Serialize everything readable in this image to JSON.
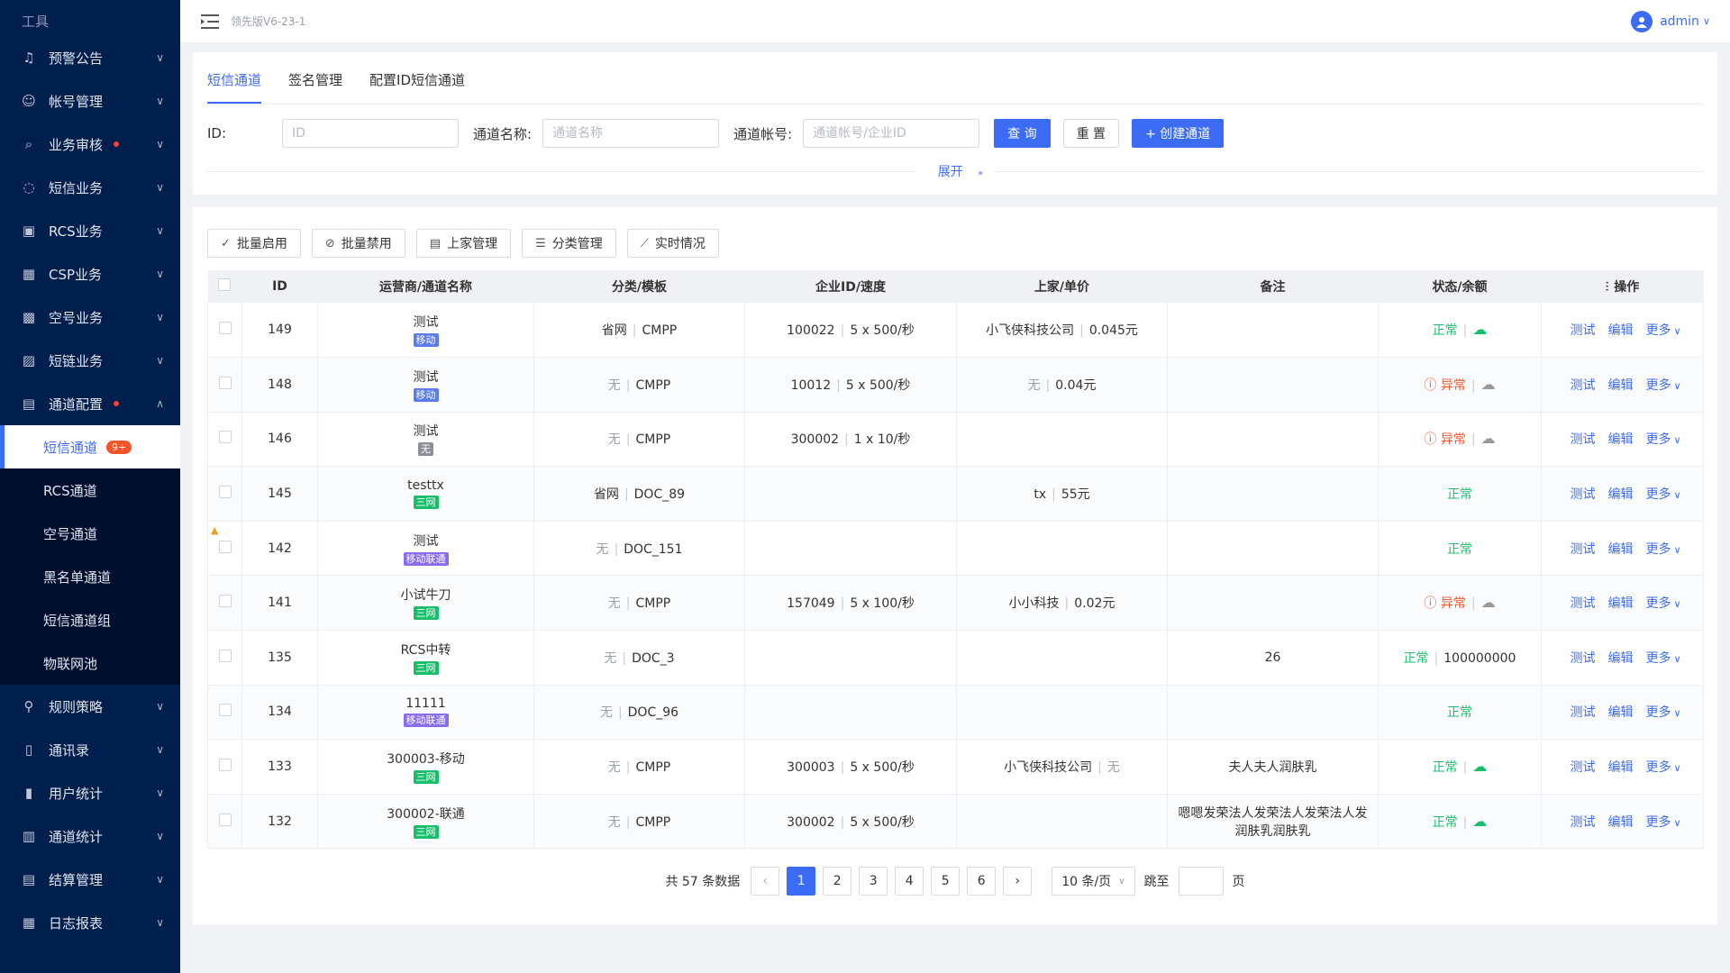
{
  "header": {
    "version": "领先版V6-23-1",
    "user": "admin"
  },
  "sidebar": {
    "top_label": "工具",
    "items": [
      {
        "label": "预警公告",
        "icon": "bell-icon",
        "dot": false
      },
      {
        "label": "帐号管理",
        "icon": "account-icon",
        "dot": false
      },
      {
        "label": "业务审核",
        "icon": "audit-icon",
        "dot": true
      },
      {
        "label": "短信业务",
        "icon": "message-icon",
        "dot": false
      },
      {
        "label": "RCS业务",
        "icon": "rcs-icon",
        "dot": false
      },
      {
        "label": "CSP业务",
        "icon": "csp-icon",
        "dot": false
      },
      {
        "label": "空号业务",
        "icon": "empty-number-icon",
        "dot": false
      },
      {
        "label": "短链业务",
        "icon": "link-icon",
        "dot": false
      },
      {
        "label": "通道配置",
        "icon": "channel-config-icon",
        "dot": true
      }
    ],
    "sub_items": [
      {
        "label": "短信通道",
        "badge": "9+",
        "active": true
      },
      {
        "label": "RCS通道"
      },
      {
        "label": "空号通道"
      },
      {
        "label": "黑名单通道"
      },
      {
        "label": "短信通道组"
      },
      {
        "label": "物联网池"
      }
    ],
    "items_after": [
      {
        "label": "规则策略",
        "icon": "rule-icon"
      },
      {
        "label": "通讯录",
        "icon": "contacts-icon"
      },
      {
        "label": "用户统计",
        "icon": "user-stats-icon"
      },
      {
        "label": "通道统计",
        "icon": "channel-stats-icon"
      },
      {
        "label": "结算管理",
        "icon": "settlement-icon"
      },
      {
        "label": "日志报表",
        "icon": "log-icon"
      }
    ]
  },
  "tabs": [
    "短信通道",
    "签名管理",
    "配置ID短信通道"
  ],
  "filters": {
    "id_label": "ID:",
    "id_placeholder": "ID",
    "name_label": "通道名称:",
    "name_placeholder": "通道名称",
    "account_label": "通道帐号:",
    "account_placeholder": "通道帐号/企业ID",
    "query": "查 询",
    "reset": "重 置",
    "create": "+ 创建通道",
    "expand": "展开"
  },
  "toolbar": [
    "批量启用",
    "批量禁用",
    "上家管理",
    "分类管理",
    "实时情况"
  ],
  "table": {
    "columns": [
      "ID",
      "运营商/通道名称",
      "分类/模板",
      "企业ID/速度",
      "上家/单价",
      "备注",
      "状态/余额",
      "操作"
    ],
    "rows": [
      {
        "id": "149",
        "name": "测试",
        "tag": "移动",
        "tag_color": "#5b7bf2",
        "cat": "省网",
        "tpl": "CMPP",
        "ent": "100022",
        "speed": "5 x 500/秒",
        "up": "小飞侠科技公司",
        "price": "0.045元",
        "note": "",
        "status": "正常",
        "status_type": "ok",
        "cloud": "ok",
        "balance": ""
      },
      {
        "id": "148",
        "name": "测试",
        "tag": "移动",
        "tag_color": "#5b7bf2",
        "cat": "无",
        "tpl": "CMPP",
        "ent": "10012",
        "speed": "5 x 500/秒",
        "up": "无",
        "price": "0.04元",
        "note": "",
        "status": "异常",
        "status_type": "err",
        "cloud": "gray",
        "balance": ""
      },
      {
        "id": "146",
        "name": "测试",
        "tag": "无",
        "tag_color": "#8a8f98",
        "cat": "无",
        "tpl": "CMPP",
        "ent": "300002",
        "speed": "1 x 10/秒",
        "up": "",
        "price": "",
        "note": "",
        "status": "异常",
        "status_type": "err",
        "cloud": "gray",
        "balance": ""
      },
      {
        "id": "145",
        "name": "testtx",
        "tag": "三网",
        "tag_color": "#19be6b",
        "cat": "省网",
        "tpl": "DOC_89",
        "ent": "",
        "speed": "",
        "up": "tx",
        "price": "55元",
        "note": "",
        "status": "正常",
        "status_type": "ok",
        "cloud": "",
        "balance": ""
      },
      {
        "id": "142",
        "name": "测试",
        "tag": "移动联通",
        "tag_color": "#8a6cf0",
        "cat": "无",
        "tpl": "DOC_151",
        "ent": "",
        "speed": "",
        "up": "",
        "price": "",
        "note": "",
        "status": "正常",
        "status_type": "ok",
        "cloud": "",
        "balance": ""
      },
      {
        "id": "141",
        "name": "小试牛刀",
        "tag": "三网",
        "tag_color": "#19be6b",
        "cat": "无",
        "tpl": "CMPP",
        "ent": "157049",
        "speed": "5 x 100/秒",
        "up": "小小科技",
        "price": "0.02元",
        "note": "",
        "status": "异常",
        "status_type": "err",
        "cloud": "gray",
        "balance": ""
      },
      {
        "id": "135",
        "name": "RCS中转",
        "tag": "三网",
        "tag_color": "#19be6b",
        "cat": "无",
        "tpl": "DOC_3",
        "ent": "",
        "speed": "",
        "up": "",
        "price": "",
        "note": "26",
        "status": "正常",
        "status_type": "ok",
        "cloud": "",
        "balance": "100000000"
      },
      {
        "id": "134",
        "name": "11111",
        "tag": "移动联通",
        "tag_color": "#8a6cf0",
        "cat": "无",
        "tpl": "DOC_96",
        "ent": "",
        "speed": "",
        "up": "",
        "price": "",
        "note": "",
        "status": "正常",
        "status_type": "ok",
        "cloud": "",
        "balance": ""
      },
      {
        "id": "133",
        "name": "300003-移动",
        "tag": "三网",
        "tag_color": "#19be6b",
        "cat": "无",
        "tpl": "CMPP",
        "ent": "300003",
        "speed": "5 x 500/秒",
        "up": "小飞侠科技公司",
        "price": "无",
        "note": "夫人夫人润肤乳",
        "status": "正常",
        "status_type": "ok",
        "cloud": "ok",
        "balance": ""
      },
      {
        "id": "132",
        "name": "300002-联通",
        "tag": "三网",
        "tag_color": "#19be6b",
        "cat": "无",
        "tpl": "CMPP",
        "ent": "300002",
        "speed": "5 x 500/秒",
        "up": "",
        "price": "",
        "note": "嗯嗯发荣法人发荣法人发荣法人发润肤乳润肤乳",
        "status": "正常",
        "status_type": "ok",
        "cloud": "ok",
        "balance": ""
      }
    ],
    "actions": [
      "测试",
      "编辑",
      "更多"
    ]
  },
  "pagination": {
    "total": "共 57 条数据",
    "pages": [
      "1",
      "2",
      "3",
      "4",
      "5",
      "6"
    ],
    "current": "1",
    "page_size": "10 条/页",
    "jump_label": "跳至",
    "page_suffix": "页"
  },
  "colors": {
    "primary": "#3c6cf5",
    "sidebar": "#001f4d",
    "ok": "#19be6b",
    "err": "#f5542b"
  }
}
